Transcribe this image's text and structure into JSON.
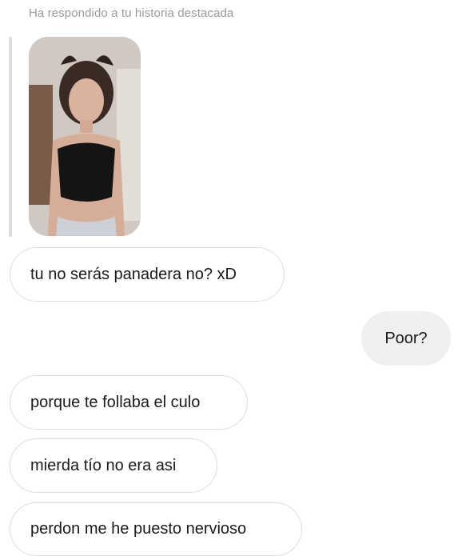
{
  "story": {
    "caption": "Ha respondido a tu historia destacada"
  },
  "messages": [
    {
      "text": "tu no serás panadera no? xD",
      "side": "sent"
    },
    {
      "text": "Poor?",
      "side": "received"
    },
    {
      "text": "porque te follaba el culo",
      "side": "sent"
    },
    {
      "text": "mierda tío no era asi",
      "side": "sent"
    },
    {
      "text": "perdon me he puesto nervioso",
      "side": "sent"
    }
  ],
  "colors": {
    "caption": "#9a9a9a",
    "sent_bubble_border": "#dedede",
    "received_bubble_bg": "#efefef",
    "reply_line": "#dcdcdc"
  }
}
